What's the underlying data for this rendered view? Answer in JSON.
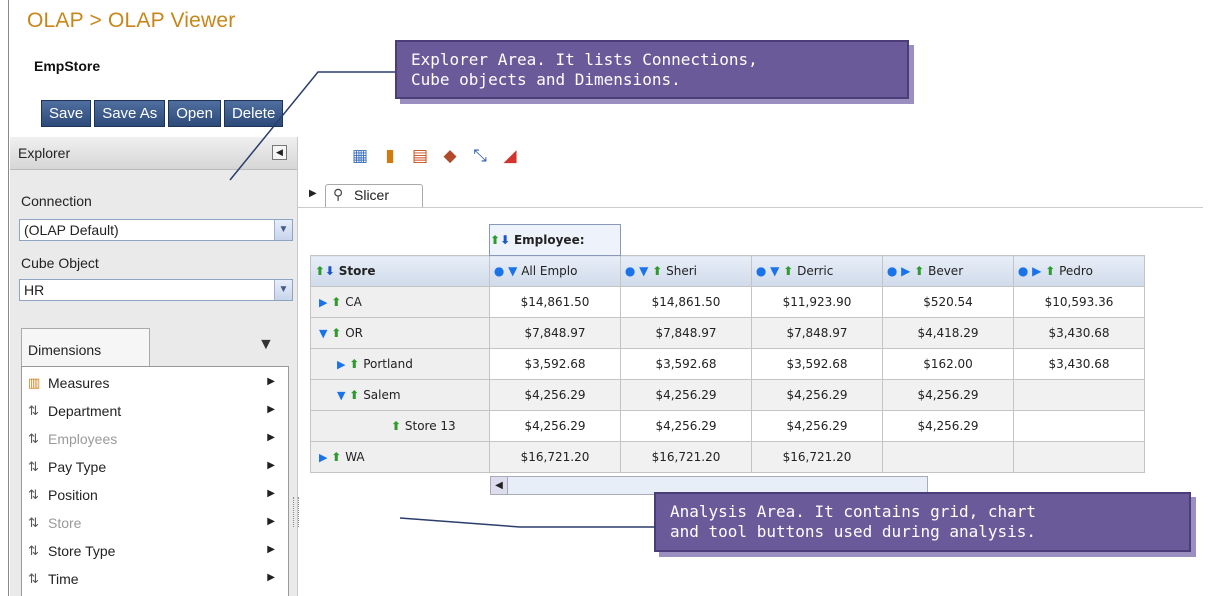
{
  "header": {
    "breadcrumb": "OLAP > OLAP Viewer",
    "cube_name": "EmpStore"
  },
  "actions": [
    "Save",
    "Save As",
    "Open",
    "Delete"
  ],
  "explorer": {
    "title": "Explorer",
    "connection_label": "Connection",
    "connection_value": "(OLAP Default)",
    "cube_label": "Cube Object",
    "cube_value": "HR",
    "dimensions_tab": "Dimensions",
    "dimensions": [
      {
        "label": "Measures",
        "icon": "measures-icon",
        "disabled": false
      },
      {
        "label": "Department",
        "icon": "hierarchy-icon",
        "disabled": false
      },
      {
        "label": "Employees",
        "icon": "hierarchy-icon",
        "disabled": true
      },
      {
        "label": "Pay Type",
        "icon": "hierarchy-icon",
        "disabled": false
      },
      {
        "label": "Position",
        "icon": "hierarchy-icon",
        "disabled": false
      },
      {
        "label": "Store",
        "icon": "hierarchy-icon",
        "disabled": true
      },
      {
        "label": "Store Type",
        "icon": "hierarchy-icon",
        "disabled": false
      },
      {
        "label": "Time",
        "icon": "hierarchy-icon",
        "disabled": false
      }
    ]
  },
  "analysis": {
    "slicer_tab": "Slicer",
    "row_dimension": "Store",
    "col_dimension": "Employee:",
    "columns": [
      "All Emplo",
      "Sheri",
      "Derric",
      "Bever",
      "Pedro"
    ],
    "rows": [
      {
        "label": "CA",
        "values": [
          "$14,861.50",
          "$14,861.50",
          "$11,923.90",
          "$520.54",
          "$10,593.36"
        ]
      },
      {
        "label": "OR",
        "values": [
          "$7,848.97",
          "$7,848.97",
          "$7,848.97",
          "$4,418.29",
          "$3,430.68"
        ]
      },
      {
        "label": "Portland",
        "values": [
          "$3,592.68",
          "$3,592.68",
          "$3,592.68",
          "$162.00",
          "$3,430.68"
        ]
      },
      {
        "label": "Salem",
        "values": [
          "$4,256.29",
          "$4,256.29",
          "$4,256.29",
          "$4,256.29",
          ""
        ]
      },
      {
        "label": "Store 13",
        "values": [
          "$4,256.29",
          "$4,256.29",
          "$4,256.29",
          "$4,256.29",
          ""
        ]
      },
      {
        "label": "WA",
        "values": [
          "$16,721.20",
          "$16,721.20",
          "$16,721.20",
          "",
          ""
        ]
      }
    ]
  },
  "callouts": {
    "explorer": "Explorer Area.  It lists Connections,\nCube objects and Dimensions.",
    "analysis": "Analysis Area.  It contains grid, chart\nand tool buttons used during analysis."
  }
}
